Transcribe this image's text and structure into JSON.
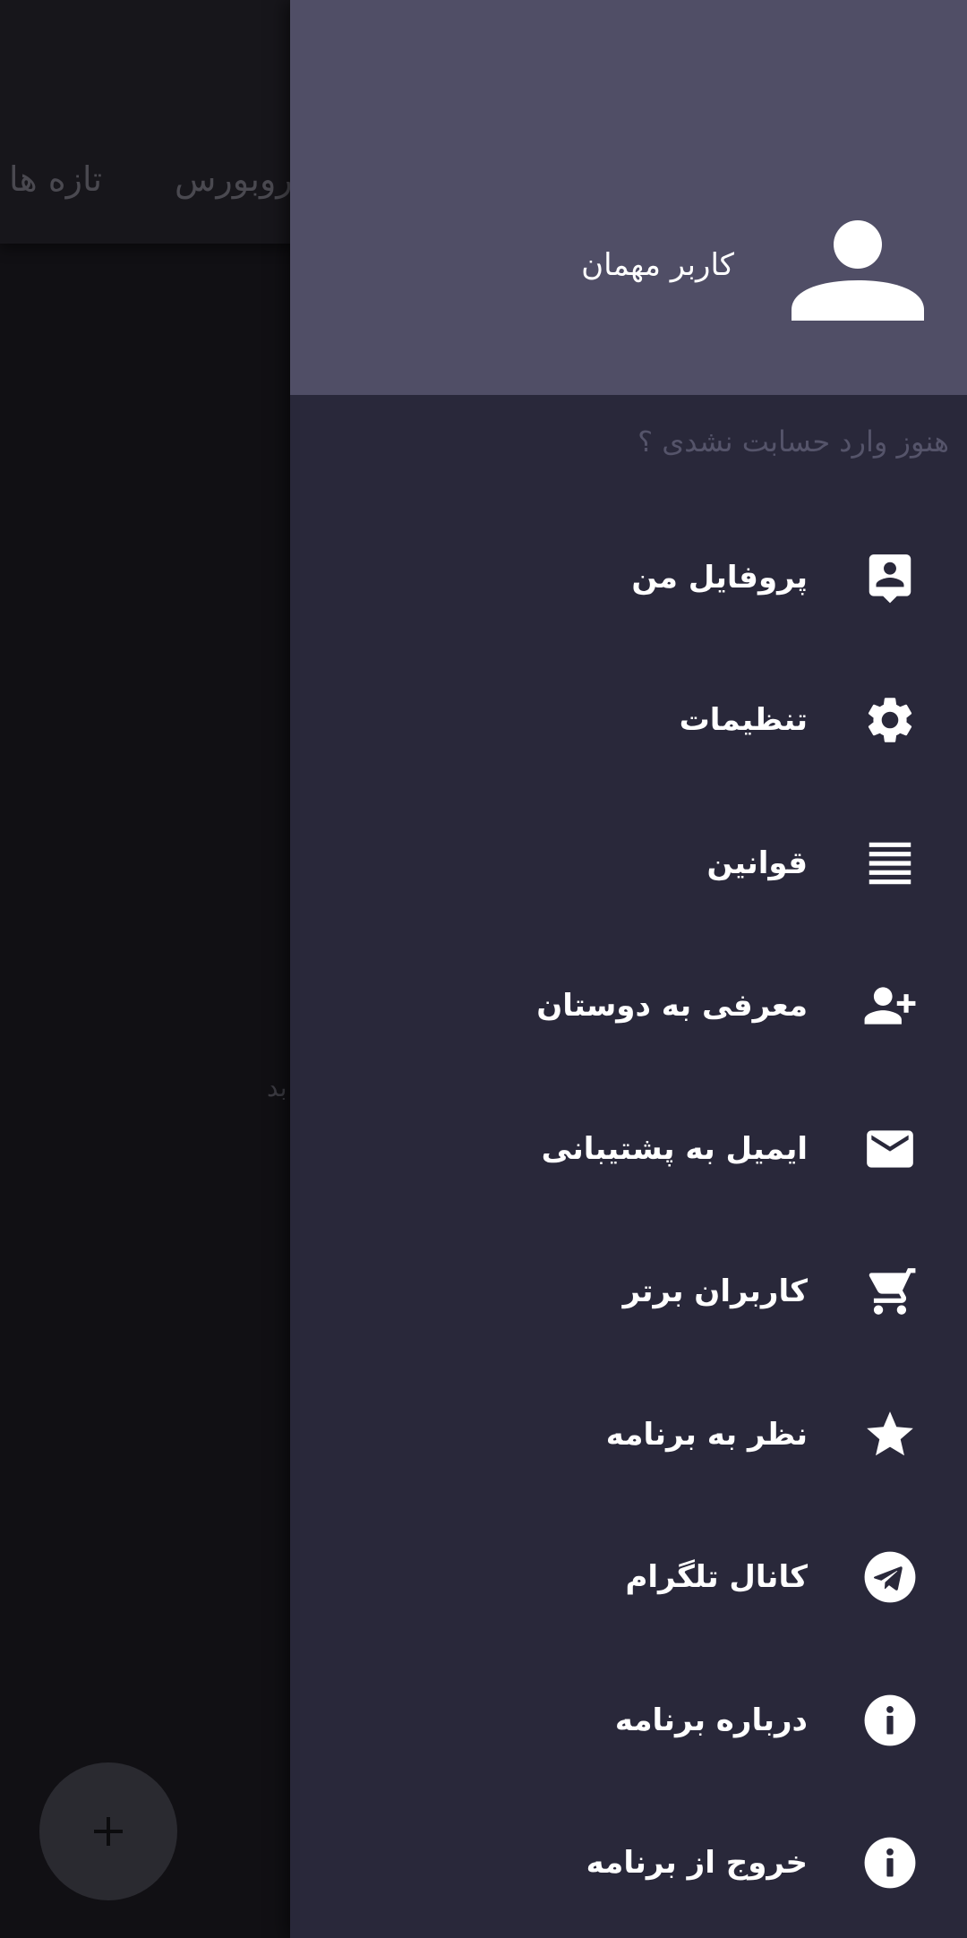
{
  "background": {
    "tabs": [
      "تازه ها",
      "روبورس"
    ],
    "body_text": "بد",
    "fab_icon": "plus-icon"
  },
  "drawer": {
    "header": {
      "avatar_icon": "person-icon",
      "guest_name": "کاربر مهمان"
    },
    "login_prompt": "هنوز وارد حسابت نشدی ؟",
    "items": [
      {
        "label": "پروفایل من",
        "icon": "account-box-icon"
      },
      {
        "label": "تنظیمات",
        "icon": "gear-icon"
      },
      {
        "label": "قوانین",
        "icon": "lines-icon"
      },
      {
        "label": "معرفی به دوستان",
        "icon": "person-add-icon"
      },
      {
        "label": "ایمیل به پشتیبانی",
        "icon": "mail-icon"
      },
      {
        "label": "کاربران برتر",
        "icon": "cart-icon"
      },
      {
        "label": "نظر به برنامه",
        "icon": "star-icon"
      },
      {
        "label": "کانال تلگرام",
        "icon": "telegram-icon"
      },
      {
        "label": "درباره برنامه",
        "icon": "info-icon"
      },
      {
        "label": "خروج از برنامه",
        "icon": "info-icon"
      }
    ]
  },
  "colors": {
    "drawer_header": "#504e66",
    "drawer_body": "#29283a",
    "scrim": "#111014",
    "text_primary": "#ffffff",
    "text_muted": "#55546a"
  }
}
